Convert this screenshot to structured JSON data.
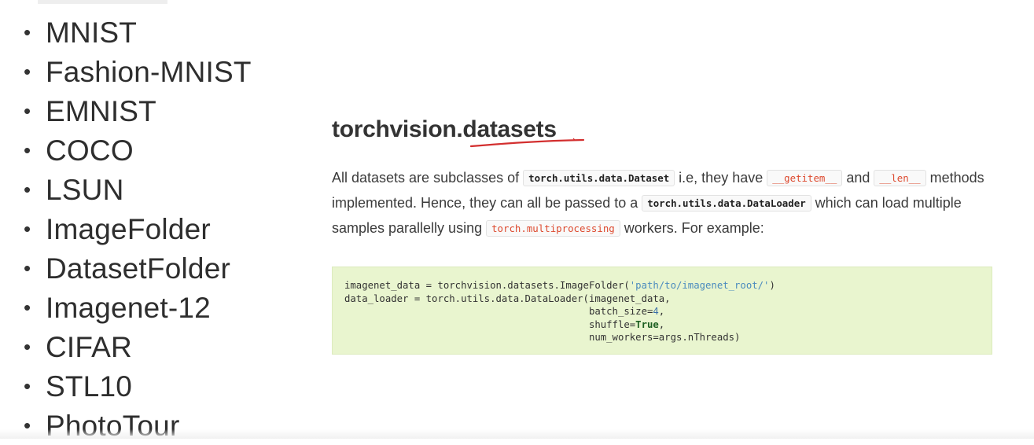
{
  "datasets_list": [
    "MNIST",
    "Fashion-MNIST",
    "EMNIST",
    "COCO",
    "LSUN",
    "ImageFolder",
    "DatasetFolder",
    "Imagenet-12",
    "CIFAR",
    "STL10",
    "PhotoTour"
  ],
  "bullet_glyph": "•",
  "doc": {
    "title": "torchvision.datasets",
    "annotation_color": "#d32f2f",
    "para": {
      "t1": "All datasets are subclasses of ",
      "c1": "torch.utils.data.Dataset",
      "t2": " i.e, they have ",
      "c2": "__getitem__",
      "t3": " and ",
      "c3": "__len__",
      "t4": " methods implemented. Hence, they can all be passed to a ",
      "c4": "torch.utils.data.DataLoader",
      "t5": " which can load multiple samples parallelly using ",
      "c5": "torch.multiprocessing",
      "t6": " workers. For example:"
    },
    "code": {
      "l1a": "imagenet_data = torchvision.datasets.ImageFolder(",
      "l1s": "'path/to/imagenet_root/'",
      "l1b": ")",
      "l2": "data_loader = torch.utils.data.DataLoader(imagenet_data,",
      "l3a": "                                          batch_size=",
      "l3n": "4",
      "l3b": ",",
      "l4a": "                                          shuffle=",
      "l4k": "True",
      "l4b": ",",
      "l5": "                                          num_workers=args.nThreads)"
    }
  }
}
